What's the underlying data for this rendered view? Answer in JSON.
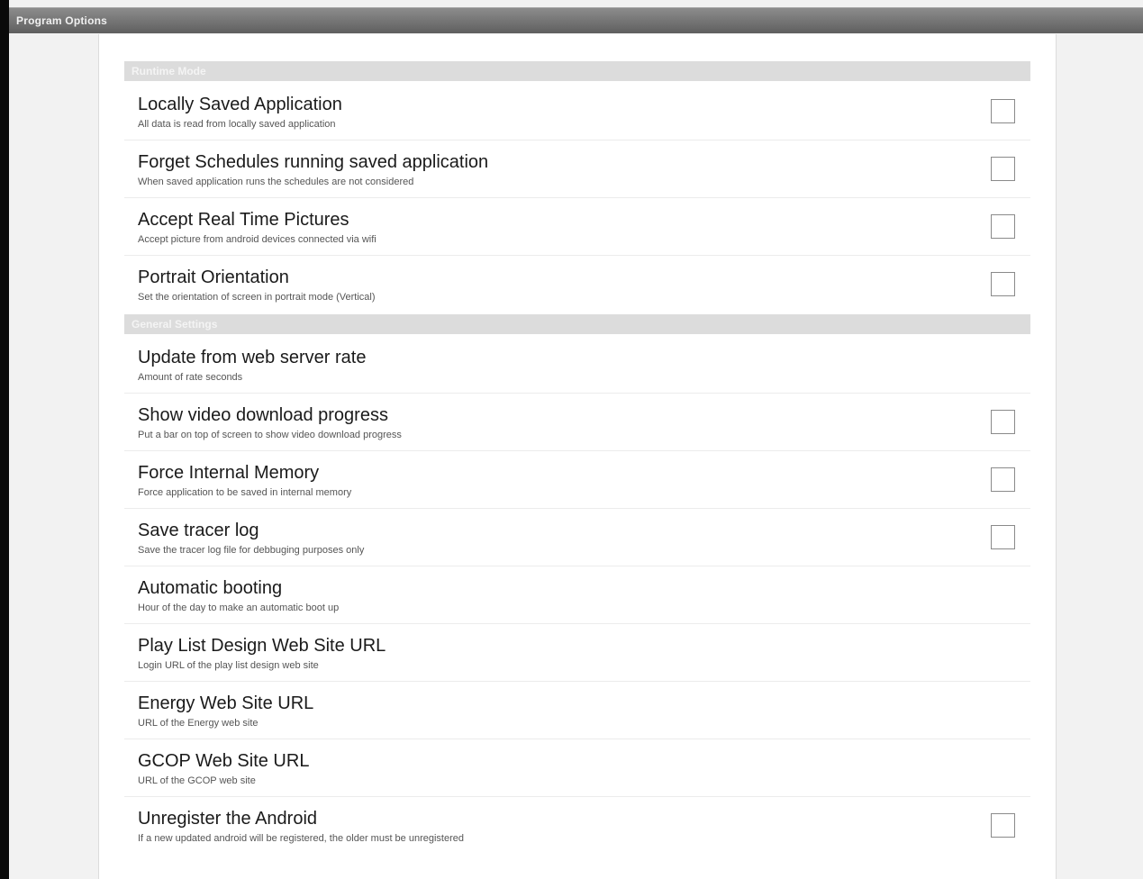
{
  "window": {
    "title": "Program Options"
  },
  "sections": [
    {
      "header": "Runtime Mode",
      "items": [
        {
          "title": "Locally Saved Application",
          "summary": "All data is read from locally saved application",
          "has_checkbox": true
        },
        {
          "title": "Forget Schedules running saved application",
          "summary": "When saved application runs the schedules are not considered",
          "has_checkbox": true
        },
        {
          "title": "Accept Real Time Pictures",
          "summary": "Accept picture from android devices connected via wifi",
          "has_checkbox": true
        },
        {
          "title": "Portrait Orientation",
          "summary": "Set the orientation of screen in portrait mode (Vertical)",
          "has_checkbox": true
        }
      ]
    },
    {
      "header": "General Settings",
      "items": [
        {
          "title": "Update from web server rate",
          "summary": "Amount of rate seconds",
          "has_checkbox": false
        },
        {
          "title": "Show video download progress",
          "summary": "Put a bar on top of screen to show video download progress",
          "has_checkbox": true
        },
        {
          "title": "Force Internal Memory",
          "summary": "Force application to be saved in internal memory",
          "has_checkbox": true
        },
        {
          "title": "Save tracer log",
          "summary": "Save the tracer log file for debbuging purposes only",
          "has_checkbox": true
        },
        {
          "title": "Automatic booting",
          "summary": "Hour of the day to make an automatic boot up",
          "has_checkbox": false
        },
        {
          "title": "Play List Design Web Site URL",
          "summary": "Login URL of the play list design web site",
          "has_checkbox": false
        },
        {
          "title": "Energy Web Site URL",
          "summary": "URL of the Energy web site",
          "has_checkbox": false
        },
        {
          "title": "GCOP Web Site URL",
          "summary": "URL of the GCOP web site",
          "has_checkbox": false
        },
        {
          "title": "Unregister the Android",
          "summary": "If a new updated android will be registered, the older must be unregistered",
          "has_checkbox": true
        }
      ]
    }
  ]
}
